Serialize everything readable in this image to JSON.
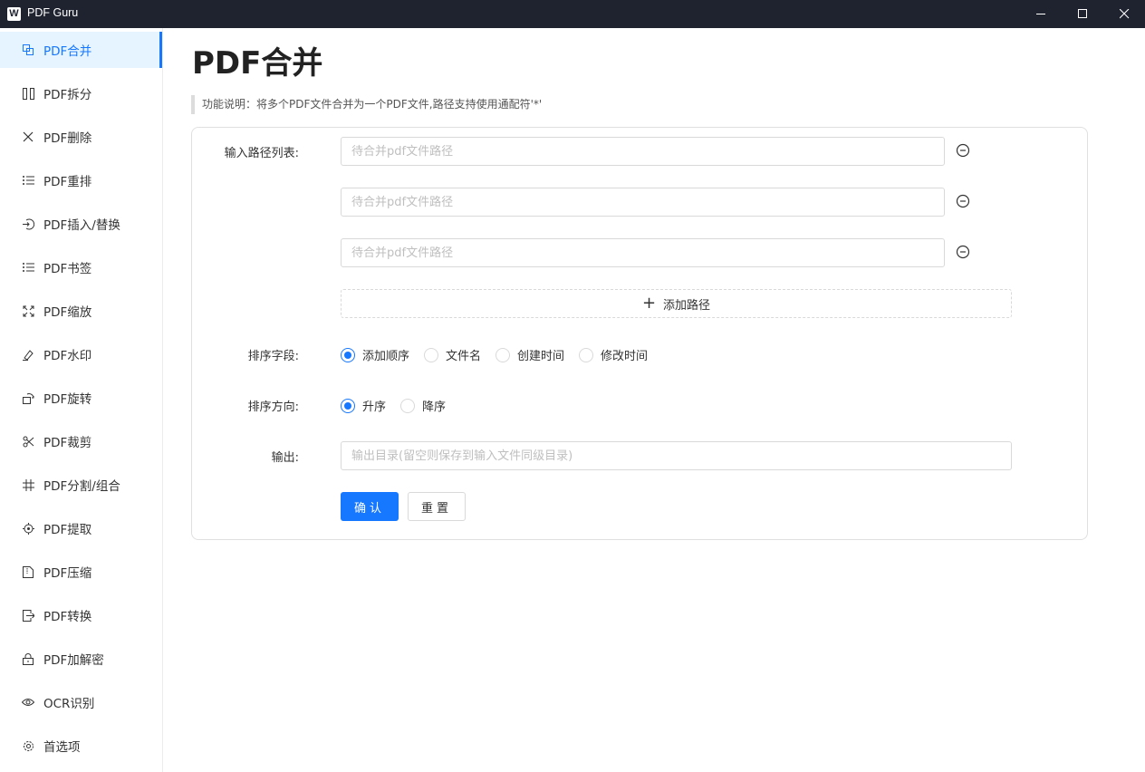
{
  "window": {
    "logo_text": "W",
    "title": "PDF Guru"
  },
  "sidebar": {
    "items": [
      {
        "label": "PDF合并",
        "icon": "merge-icon"
      },
      {
        "label": "PDF拆分",
        "icon": "split-icon"
      },
      {
        "label": "PDF删除",
        "icon": "delete-x-icon"
      },
      {
        "label": "PDF重排",
        "icon": "reorder-list-icon"
      },
      {
        "label": "PDF插入/替换",
        "icon": "insert-icon"
      },
      {
        "label": "PDF书签",
        "icon": "bookmark-list-icon"
      },
      {
        "label": "PDF缩放",
        "icon": "scale-icon"
      },
      {
        "label": "PDF水印",
        "icon": "watermark-pen-icon"
      },
      {
        "label": "PDF旋转",
        "icon": "rotate-icon"
      },
      {
        "label": "PDF裁剪",
        "icon": "scissors-icon"
      },
      {
        "label": "PDF分割/组合",
        "icon": "grid-hash-icon"
      },
      {
        "label": "PDF提取",
        "icon": "target-icon"
      },
      {
        "label": "PDF压缩",
        "icon": "compress-file-icon"
      },
      {
        "label": "PDF转换",
        "icon": "export-icon"
      },
      {
        "label": "PDF加解密",
        "icon": "lock-icon"
      },
      {
        "label": "OCR识别",
        "icon": "eye-icon"
      },
      {
        "label": "首选项",
        "icon": "gear-icon"
      }
    ],
    "active_index": 0
  },
  "main": {
    "title": "PDF合并",
    "description": "功能说明：将多个PDF文件合并为一个PDF文件,路径支持使用通配符'*'",
    "form": {
      "input_list_label": "输入路径列表:",
      "input_placeholder": "待合并pdf文件路径",
      "input_values": [
        "",
        "",
        ""
      ],
      "add_path_label": "添加路径",
      "sort_field_label": "排序字段:",
      "sort_field_options": [
        "添加顺序",
        "文件名",
        "创建时间",
        "修改时间"
      ],
      "sort_field_selected": "添加顺序",
      "sort_dir_label": "排序方向:",
      "sort_dir_options": [
        "升序",
        "降序"
      ],
      "sort_dir_selected": "升序",
      "output_label": "输出:",
      "output_placeholder": "输出目录(留空则保存到输入文件同级目录)",
      "output_value": "",
      "confirm_label": "确认",
      "reset_label": "重置"
    }
  },
  "colors": {
    "accent": "#1677ff",
    "titlebar": "#1f2330"
  }
}
